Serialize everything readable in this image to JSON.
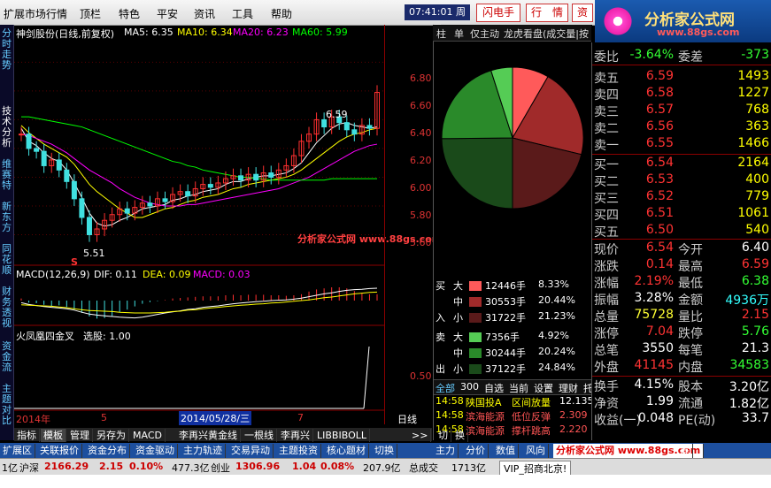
{
  "menu": {
    "items": [
      "扩展市场行情",
      "顶栏",
      "特色",
      "平安",
      "资讯",
      "工具",
      "帮助"
    ],
    "clock": "07:41:01 周二",
    "btn_flash": "闪电手",
    "btn_quote": "行　情",
    "btn_more": "资"
  },
  "logo": {
    "title": "分析家公式网",
    "url": "www.88gs.com"
  },
  "vtabs": [
    "分时走势",
    "技术分析",
    "维赛特",
    "新东方",
    "同花顺",
    "财务透视",
    "资金流",
    "主题对比"
  ],
  "chart": {
    "title": "神剑股份(日线,前复权)",
    "ma": [
      {
        "label": "MA5: 6.35",
        "color": "#ffffff"
      },
      {
        "label": "MA10: 6.34",
        "color": "#ffff00"
      },
      {
        "label": "MA20: 6.23",
        "color": "#ff00ff"
      },
      {
        "label": "MA60: 5.99",
        "color": "#00ff00"
      }
    ],
    "high_label": "6.59",
    "low_label": "5.51",
    "s_marker": "S",
    "watermark": "分析家公式网 www.88gs.com",
    "macd_title": "MACD(12,26,9)",
    "dif": "DIF: 0.11",
    "dea": "DEA: 0.09",
    "macd": "MACD: 0.03",
    "signal_title": "火凤凰四金叉",
    "signal_value": "选股: 1.00",
    "date_left": "2014年",
    "date_mid1": "5",
    "date_cursor": "2014/05/28/三",
    "date_mid2": "7"
  },
  "chart_data": {
    "type": "line",
    "title": "神剑股份(日线,前复权)",
    "yticks": [
      "6.80",
      "6.60",
      "6.40",
      "6.20",
      "6.00",
      "5.80",
      "5.60",
      "0.50"
    ],
    "ylim": [
      5.4,
      6.95
    ],
    "close": [
      6.3,
      6.2,
      6.18,
      6.08,
      6.12,
      6.05,
      5.97,
      5.85,
      5.72,
      5.6,
      5.64,
      5.7,
      5.74,
      5.78,
      5.75,
      5.79,
      5.82,
      5.8,
      5.85,
      5.83,
      5.88,
      5.9,
      5.87,
      5.92,
      5.95,
      5.93,
      5.96,
      5.99,
      6.01,
      5.98,
      6.02,
      5.98,
      6.03,
      6.0,
      6.05,
      6.08,
      6.15,
      6.25,
      6.3,
      6.4,
      6.35,
      6.42,
      6.38,
      6.33,
      6.3,
      6.36,
      6.34,
      6.59
    ],
    "series": [
      {
        "name": "MA5",
        "values": [
          6.34,
          6.25,
          6.22,
          6.17,
          6.13,
          6.11,
          6.05,
          5.96,
          5.86,
          5.75,
          5.68,
          5.66,
          5.67,
          5.7,
          5.72,
          5.75,
          5.78,
          5.79,
          5.8,
          5.81,
          5.84,
          5.85,
          5.87,
          5.88,
          5.9,
          5.91,
          5.92,
          5.95,
          5.97,
          5.97,
          5.99,
          6.0,
          6.01,
          6.01,
          6.02,
          6.03,
          6.06,
          6.1,
          6.17,
          6.24,
          6.29,
          6.34,
          6.37,
          6.38,
          6.36,
          6.35,
          6.34,
          6.35
        ]
      },
      {
        "name": "MA10",
        "values": [
          6.36,
          6.31,
          6.27,
          6.23,
          6.2,
          6.17,
          6.14,
          6.09,
          6.02,
          5.95,
          5.9,
          5.86,
          5.82,
          5.78,
          5.75,
          5.72,
          5.72,
          5.74,
          5.76,
          5.78,
          5.79,
          5.81,
          5.83,
          5.84,
          5.86,
          5.87,
          5.88,
          5.9,
          5.92,
          5.93,
          5.95,
          5.96,
          5.97,
          5.98,
          5.99,
          6.0,
          6.02,
          6.05,
          6.09,
          6.13,
          6.17,
          6.21,
          6.25,
          6.28,
          6.3,
          6.31,
          6.33,
          6.34
        ]
      },
      {
        "name": "MA20",
        "values": [
          6.3,
          6.29,
          6.27,
          6.25,
          6.23,
          6.2,
          6.17,
          6.13,
          6.09,
          6.05,
          6.02,
          5.99,
          5.96,
          5.92,
          5.89,
          5.86,
          5.84,
          5.82,
          5.81,
          5.8,
          5.8,
          5.8,
          5.81,
          5.81,
          5.82,
          5.83,
          5.84,
          5.85,
          5.86,
          5.87,
          5.88,
          5.89,
          5.9,
          5.91,
          5.92,
          5.94,
          5.96,
          5.98,
          6.0,
          6.03,
          6.06,
          6.09,
          6.12,
          6.15,
          6.18,
          6.2,
          6.22,
          6.23
        ]
      },
      {
        "name": "MA60",
        "values": [
          6.42,
          6.42,
          6.41,
          6.4,
          6.39,
          6.38,
          6.37,
          6.36,
          6.35,
          6.33,
          6.31,
          6.29,
          6.27,
          6.25,
          6.23,
          6.21,
          6.19,
          6.17,
          6.15,
          6.13,
          6.11,
          6.1,
          6.08,
          6.07,
          6.05,
          6.04,
          6.03,
          6.02,
          6.01,
          6.0,
          6.0,
          5.99,
          5.99,
          5.98,
          5.98,
          5.98,
          5.98,
          5.98,
          5.98,
          5.98,
          5.98,
          5.99,
          5.99,
          5.99,
          5.99,
          5.99,
          5.99,
          5.99
        ]
      }
    ]
  },
  "midpanel": {
    "tabs": [
      "柱",
      "单",
      "仅主动",
      "龙虎看盘(成交量|按"
    ],
    "buy_label": "买",
    "sell_label": "卖",
    "in_label": "入",
    "out_label": "出",
    "buy": [
      {
        "size": "大",
        "vol": "12446手",
        "pct": "8.33%",
        "color": "#ff5a5a"
      },
      {
        "size": "中",
        "vol": "30553手",
        "pct": "20.44%",
        "color": "#a02a2a"
      },
      {
        "size": "小",
        "vol": "31722手",
        "pct": "21.23%",
        "color": "#5a1a1a"
      }
    ],
    "sell": [
      {
        "size": "大",
        "vol": "7356手",
        "pct": "4.92%",
        "color": "#55cc55"
      },
      {
        "size": "中",
        "vol": "30244手",
        "pct": "20.24%",
        "color": "#2a8a2a"
      },
      {
        "size": "小",
        "vol": "37122手",
        "pct": "24.84%",
        "color": "#1a4a1a"
      }
    ],
    "pie": [
      {
        "pct": 8.33,
        "color": "#ff5a5a"
      },
      {
        "pct": 20.44,
        "color": "#a02a2a"
      },
      {
        "pct": 21.23,
        "color": "#5a1a1a"
      },
      {
        "pct": 24.84,
        "color": "#1a4a1a"
      },
      {
        "pct": 20.24,
        "color": "#2a8a2a"
      },
      {
        "pct": 4.92,
        "color": "#55cc55"
      }
    ],
    "bar_items": [
      "全部",
      "300",
      "自选",
      "当前",
      "设置",
      "理财",
      "托"
    ],
    "news": [
      {
        "time": "14:58",
        "name": "陕国投A",
        "desc": "区间放量",
        "val": "12.135"
      },
      {
        "time": "14:58",
        "name": "滨海能源",
        "desc": "低位反弹",
        "val": "2.309"
      },
      {
        "time": "14:58",
        "name": "滨海能源",
        "desc": "撑杆跳高",
        "val": "2.220"
      }
    ]
  },
  "quote": {
    "ratio_k": "委比",
    "ratio_v": "-3.64%",
    "diff_k": "委差",
    "diff_v": "-373",
    "asks": [
      {
        "k": "卖五",
        "p": "6.59",
        "v": "1493"
      },
      {
        "k": "卖四",
        "p": "6.58",
        "v": "1227"
      },
      {
        "k": "卖三",
        "p": "6.57",
        "v": "768"
      },
      {
        "k": "卖二",
        "p": "6.56",
        "v": "363"
      },
      {
        "k": "卖一",
        "p": "6.55",
        "v": "1466"
      }
    ],
    "bids": [
      {
        "k": "买一",
        "p": "6.54",
        "v": "2164"
      },
      {
        "k": "买二",
        "p": "6.53",
        "v": "400"
      },
      {
        "k": "买三",
        "p": "6.52",
        "v": "779"
      },
      {
        "k": "买四",
        "p": "6.51",
        "v": "1061"
      },
      {
        "k": "买五",
        "p": "6.50",
        "v": "540"
      }
    ],
    "stats": [
      {
        "k1": "现价",
        "v1": "6.54",
        "c1": "red",
        "k2": "今开",
        "v2": "6.40",
        "c2": "wht"
      },
      {
        "k1": "涨跌",
        "v1": "0.14",
        "c1": "red",
        "k2": "最高",
        "v2": "6.59",
        "c2": "red"
      },
      {
        "k1": "涨幅",
        "v1": "2.19%",
        "c1": "red",
        "k2": "最低",
        "v2": "6.38",
        "c2": "green"
      },
      {
        "k1": "振幅",
        "v1": "3.28%",
        "c1": "wht",
        "k2": "金额",
        "v2": "4936万",
        "c2": "cyan"
      },
      {
        "k1": "总量",
        "v1": "75728",
        "c1": "yel",
        "k2": "量比",
        "v2": "2.15",
        "c2": "red"
      },
      {
        "k1": "涨停",
        "v1": "7.04",
        "c1": "red",
        "k2": "跌停",
        "v2": "5.76",
        "c2": "green"
      },
      {
        "k1": "总笔",
        "v1": "3550",
        "c1": "wht",
        "k2": "每笔",
        "v2": "21.3",
        "c2": "wht"
      },
      {
        "k1": "外盘",
        "v1": "41145",
        "c1": "red",
        "k2": "内盘",
        "v2": "34583",
        "c2": "green"
      }
    ],
    "stats2": [
      {
        "k1": "换手",
        "v1": "4.15%",
        "k2": "股本",
        "v2": "3.20亿"
      },
      {
        "k1": "净资",
        "v1": "1.99",
        "k2": "流通",
        "v2": "1.82亿"
      },
      {
        "k1": "收益(一)",
        "v1": "0.048",
        "k2": "PE(动)",
        "v2": "33.7"
      }
    ]
  },
  "tabs1": [
    "指标",
    "模板",
    "管理",
    "另存为",
    "MACD",
    "李再兴黄金线",
    "一根线",
    "李再兴",
    "LIBBIBOLL",
    ">>",
    "切",
    "换"
  ],
  "daily_label": "日线",
  "tabs2": [
    "扩展区",
    "关联报价",
    "资金分布",
    "资金驱动",
    "主力轨迹",
    "交易异动",
    "主题投资",
    "核心题材",
    "切换"
  ],
  "tabs2_right": [
    "主力",
    "分价",
    "数值",
    "风向",
    "分析家公式网 www.88gs.com",
    "筹"
  ],
  "status": {
    "s1": "1亿",
    "s2": "沪深",
    "s3": "2166.29",
    "s4": "2.15",
    "s5": "0.10%",
    "s6": "477.3亿",
    "s7": "创业",
    "s8": "1306.96",
    "s9": "1.04",
    "s10": "0.08%",
    "s11": "207.9亿",
    "s12": "总成交",
    "s13": "1713亿",
    "s14": "VIP_招商北京!"
  }
}
